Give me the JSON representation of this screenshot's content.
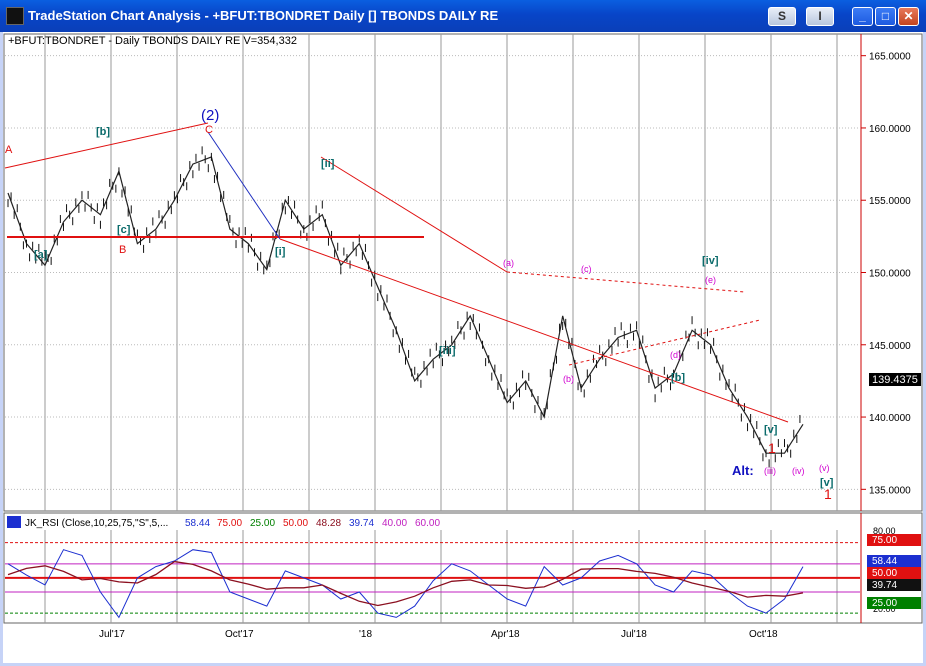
{
  "window": {
    "title": "TradeStation Chart Analysis - +BFUT:TBONDRET Daily [] TBONDS DAILY RE",
    "s_button": "S",
    "i_button": "I",
    "min_glyph": "_",
    "max_glyph": "□",
    "close_glyph": "✕"
  },
  "header": {
    "symbol_info": "+BFUT:TBONDRET - Daily  TBONDS DAILY RE  V=354,332"
  },
  "price_axis": {
    "ticks": [
      "165.0000",
      "160.0000",
      "155.0000",
      "150.0000",
      "145.0000",
      "140.0000",
      "135.0000"
    ],
    "last_price": "139.4375"
  },
  "wave_labels": {
    "A": "A",
    "b_sq": "[b]",
    "a_sq": "[a]",
    "c_sq": "[c]",
    "B": "B",
    "wave2": "(2)",
    "C": "C",
    "ii": "[ii]",
    "i": "[i]",
    "iii": "[iii]",
    "a_p": "(a)",
    "b_p": "(b)",
    "c_p": "(c)",
    "iv_sq": "[iv]",
    "e_p": "(e)",
    "d_p": "(d)",
    "b_sq2": "[b]",
    "v_sq": "[v]",
    "one": "1",
    "alt": "Alt:",
    "iii_p": "(iii)",
    "iv_p": "(iv)",
    "v_p": "(v)",
    "v_sq2": "[v]",
    "one_b": "1"
  },
  "indicator": {
    "header": "JK_RSI (Close,10,25,75,\"S\",5,...",
    "values": [
      "58.44",
      "75.00",
      "25.00",
      "50.00",
      "48.28",
      "39.74",
      "40.00",
      "60.00"
    ],
    "axis_ticks": [
      "80.00",
      "20.00"
    ],
    "flags": [
      "75.00",
      "58.44",
      "50.00",
      "39.74",
      "25.00"
    ]
  },
  "time_axis": {
    "labels": [
      "Jul'17",
      "Oct'17",
      "'18",
      "Apr'18",
      "Jul'18",
      "Oct'18"
    ]
  },
  "colors": {
    "accent_red": "#e01010",
    "wave_teal": "#0b6b6b",
    "wave_magenta": "#d000d0",
    "wave_blue": "#1010c0",
    "rsi_blue": "#1c2fd0",
    "rsi_maroon": "#8b1020"
  },
  "chart_data": {
    "type": "line",
    "title": "+BFUT:TBONDRET - Daily  TBONDS DAILY RE",
    "ylim": [
      133.5,
      166.5
    ],
    "y_ticks": [
      135,
      140,
      145,
      150,
      155,
      160,
      165
    ],
    "x_labels": [
      "Jul'17",
      "Oct'17",
      "'18",
      "Apr'18",
      "Jul'18",
      "Oct'18"
    ],
    "series": [
      {
        "values": [
          155.5,
          152,
          150.5,
          153.5,
          155,
          154,
          157,
          152,
          153,
          155,
          157.5,
          158,
          153,
          152,
          150.2,
          155,
          153,
          154,
          150.5,
          152,
          149,
          146,
          142.5,
          144,
          145,
          147,
          144,
          141,
          142.5,
          140,
          147,
          142,
          144,
          145.5,
          146,
          142,
          143,
          146,
          145,
          142,
          140,
          137.5,
          137.5,
          139.5
        ]
      }
    ],
    "rsi_series": {
      "ylim": [
        18,
        84
      ],
      "levels": [
        75,
        50,
        25
      ],
      "values": [
        60,
        52,
        45,
        70,
        66,
        40,
        22,
        50,
        58,
        62,
        70,
        68,
        40,
        35,
        30,
        55,
        50,
        45,
        35,
        40,
        25,
        22,
        30,
        48,
        60,
        55,
        45,
        35,
        30,
        58,
        45,
        50,
        62,
        66,
        60,
        45,
        40,
        55,
        52,
        40,
        30,
        25,
        35,
        58
      ]
    }
  }
}
